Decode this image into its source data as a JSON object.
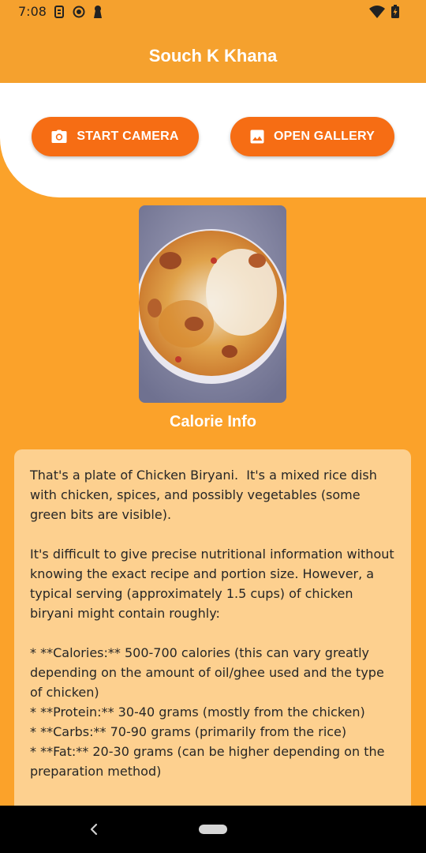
{
  "status_bar": {
    "time": "7:08",
    "icons_left": [
      "sim-card-icon",
      "record-icon",
      "keyhole-icon"
    ],
    "icons_right": [
      "wifi-icon",
      "battery-charging-icon"
    ]
  },
  "app_bar": {
    "title": "Souch K Khana"
  },
  "actions": {
    "camera_label": "START CAMERA",
    "gallery_label": "OPEN GALLERY"
  },
  "result": {
    "image_subject": "chicken-biryani-photo",
    "heading": "Calorie Info",
    "text": "That's a plate of Chicken Biryani.  It's a mixed rice dish with chicken, spices, and possibly vegetables (some green bits are visible).\n\nIt's difficult to give precise nutritional information without knowing the exact recipe and portion size. However, a typical serving (approximately 1.5 cups) of chicken biryani might contain roughly:\n\n* **Calories:** 500-700 calories (this can vary greatly depending on the amount of oil/ghee used and the type of chicken)\n* **Protein:** 30-40 grams (mostly from the chicken)\n* **Carbs:** 70-90 grams (primarily from the rice)\n* **Fat:** 20-30 grams (can be higher depending on the preparation method)"
  },
  "nav": {
    "icons": [
      "back-icon",
      "home-pill-icon"
    ]
  },
  "colors": {
    "background": "#FBA22A",
    "app_bar": "#F5A12E",
    "button": "#F66D14",
    "card": "#FDD08F"
  }
}
